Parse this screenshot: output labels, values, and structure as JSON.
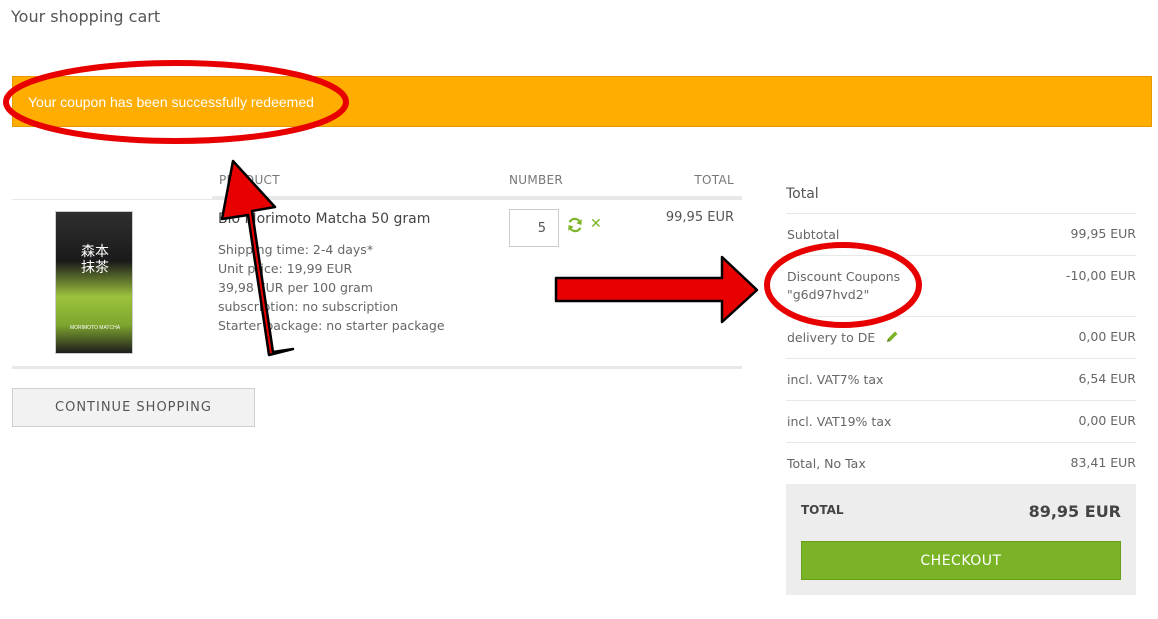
{
  "page": {
    "title": "Your shopping cart"
  },
  "banner": {
    "message": "Your coupon has been successfully redeemed",
    "color": "#ffad00"
  },
  "cart": {
    "headers": {
      "product": "PRODUCT",
      "number": "NUMBER",
      "total": "TOTAL"
    },
    "items": [
      {
        "name": "Bio Morimoto Matcha 50 gram",
        "shipping": "Shipping time: 2-4 days*",
        "unit_price": "Unit price: 19,99 EUR",
        "base_price": "39,98 EUR per 100 gram",
        "subscription": "subscription: no subscription",
        "starter": "Starter package: no starter package",
        "quantity": "5",
        "total": "99,95 EUR",
        "image": {
          "kanji": "森本抹茶",
          "brand": "MORIMOTO MATCHA"
        }
      }
    ],
    "continue_label": "CONTINUE SHOPPING"
  },
  "summary": {
    "title": "Total",
    "rows": [
      {
        "label": "Subtotal",
        "value": "99,95 EUR"
      },
      {
        "label": "Discount Coupons",
        "label2": "\"g6d97hvd2\"",
        "value": "-10,00 EUR"
      },
      {
        "label": "delivery to DE",
        "value": "0,00 EUR"
      },
      {
        "label": "incl. VAT7% tax",
        "value": "6,54 EUR"
      },
      {
        "label": "incl. VAT19% tax",
        "value": "0,00 EUR"
      },
      {
        "label": "Total, No Tax",
        "value": "83,41 EUR"
      }
    ],
    "grand_total_label": "TOTAL",
    "grand_total_value": "89,95 EUR",
    "checkout_label": "CHECKOUT"
  },
  "icons": {
    "refresh": "refresh-icon",
    "remove": "close-icon",
    "edit": "pencil-icon"
  },
  "colors": {
    "accent_green": "#7ab325",
    "annotation_red": "#e80000"
  }
}
